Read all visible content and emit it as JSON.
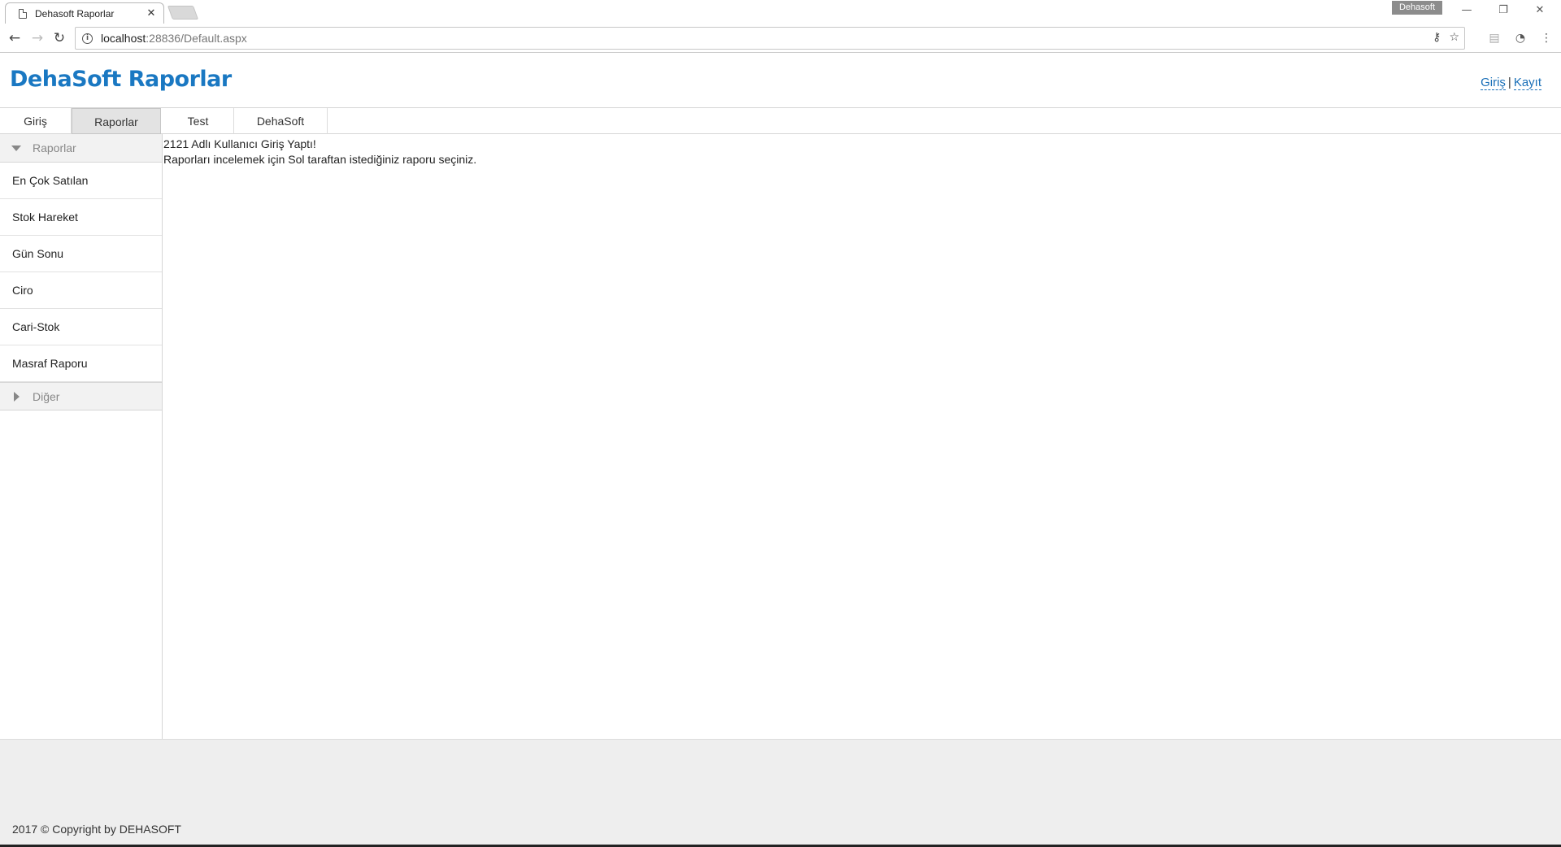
{
  "browser": {
    "tab_title": "Dehasoft Raporlar",
    "tab_close": "✕",
    "profile_name": "Dehasoft",
    "url_host": "localhost",
    "url_path": ":28836/Default.aspx",
    "controls": {
      "minimize": "—",
      "restore": "❐",
      "close": "✕"
    },
    "nav": {
      "back": "←",
      "forward": "→",
      "reload": "↻"
    },
    "omni_icons": {
      "key": "⚷",
      "star": "☆"
    },
    "ext_icons": {
      "pdf": "▤",
      "speed": "◔",
      "menu": "⋮"
    }
  },
  "header": {
    "title": "DehaSoft Raporlar",
    "login_link": "Giriş",
    "separator": "|",
    "register_link": "Kayıt"
  },
  "menu": {
    "items": [
      {
        "label": "Giriş"
      },
      {
        "label": "Raporlar",
        "active": true
      },
      {
        "label": "Test"
      },
      {
        "label": "DehaSoft"
      }
    ]
  },
  "sidebar": {
    "group_open": "Raporlar",
    "items": [
      {
        "label": "En Çok Satılan"
      },
      {
        "label": "Stok Hareket"
      },
      {
        "label": "Gün Sonu"
      },
      {
        "label": "Ciro"
      },
      {
        "label": "Cari-Stok"
      },
      {
        "label": "Masraf Raporu"
      }
    ],
    "group_closed": "Diğer"
  },
  "content": {
    "line1": "2121 Adlı Kullanıcı Giriş Yaptı!",
    "line2": "Raporları incelemek için Sol taraftan istediğiniz raporu seçiniz."
  },
  "footer": {
    "copyright": "2017 © Copyright by DEHASOFT"
  }
}
